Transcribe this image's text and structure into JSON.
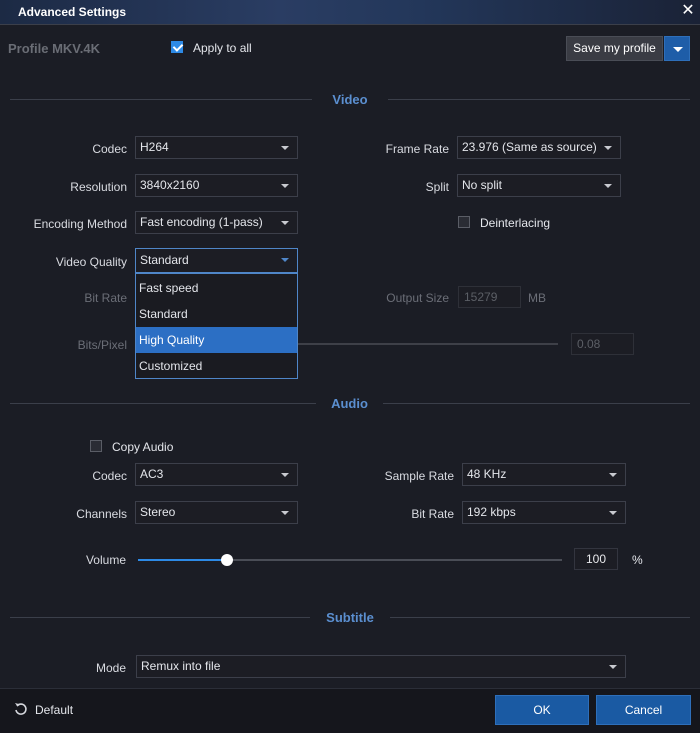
{
  "window": {
    "title": "Advanced Settings",
    "close_glyph": "✕"
  },
  "profile": {
    "label": "Profile",
    "name": "MKV.4K",
    "apply_to_all_label": "Apply to all",
    "apply_to_all_checked": true
  },
  "toolbar": {
    "save_profile_label": "Save my profile"
  },
  "video": {
    "section_title": "Video",
    "codec": {
      "label": "Codec",
      "value": "H264"
    },
    "resolution": {
      "label": "Resolution",
      "value": "3840x2160"
    },
    "encoding_method": {
      "label": "Encoding Method",
      "value": "Fast encoding (1-pass)"
    },
    "video_quality": {
      "label": "Video Quality",
      "value": "Standard",
      "options": [
        "Fast speed",
        "Standard",
        "High Quality",
        "Customized"
      ],
      "highlighted": "High Quality"
    },
    "bit_rate": {
      "label": "Bit Rate"
    },
    "bits_per_pixel": {
      "label": "Bits/Pixel",
      "value": "0.08"
    },
    "frame_rate": {
      "label": "Frame Rate",
      "value": "23.976 (Same as source)"
    },
    "split": {
      "label": "Split",
      "value": "No split"
    },
    "deinterlacing": {
      "label": "Deinterlacing",
      "checked": false
    },
    "output_size": {
      "label": "Output Size",
      "value": "15279",
      "unit": "MB"
    }
  },
  "audio": {
    "section_title": "Audio",
    "copy_audio": {
      "label": "Copy Audio",
      "checked": false
    },
    "codec": {
      "label": "Codec",
      "value": "AC3"
    },
    "channels": {
      "label": "Channels",
      "value": "Stereo"
    },
    "sample_rate": {
      "label": "Sample Rate",
      "value": "48 KHz"
    },
    "bit_rate": {
      "label": "Bit Rate",
      "value": "192 kbps"
    },
    "volume": {
      "label": "Volume",
      "value": "100",
      "unit": "%",
      "level_fraction": 0.21
    }
  },
  "subtitle": {
    "section_title": "Subtitle",
    "mode": {
      "label": "Mode",
      "value": "Remux into file"
    }
  },
  "footer": {
    "default_label": "Default",
    "ok_label": "OK",
    "cancel_label": "Cancel"
  },
  "colors": {
    "accent": "#2d8ae6",
    "section_title": "#5b8fd0",
    "ok_button": "#1a5aa3",
    "highlight": "#2c6fc4"
  }
}
